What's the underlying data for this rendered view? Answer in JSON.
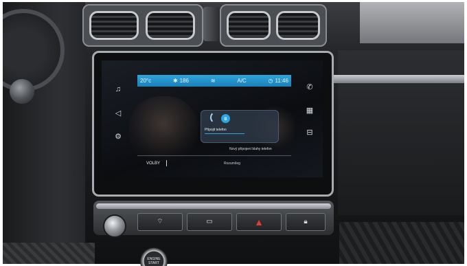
{
  "status_bar": {
    "temp_left": "20°c",
    "fan_level": "186",
    "ac_label": "A/C",
    "time": "11:46"
  },
  "popup": {
    "title": "Připojit telefon",
    "pair_new": "Nový připojení blahy telefon"
  },
  "bottom_bar": {
    "options_label": "VOLBY",
    "connecting_text": "Rozumíleg"
  },
  "side_icons": {
    "left": [
      "music-note-icon",
      "navigation-icon",
      "car-settings-icon"
    ],
    "right": [
      "phone-icon",
      "apps-grid-icon",
      "vehicle-icon"
    ]
  },
  "console_buttons": [
    "defrost-front-icon",
    "defrost-rear-icon",
    "hazard-icon",
    "lock-icon"
  ],
  "start_button": {
    "line1": "ENGINE",
    "line2": "START"
  },
  "colors": {
    "status_bar": "#1b7fb8",
    "accent": "#2aa6e0",
    "hazard": "#e23b3b"
  }
}
